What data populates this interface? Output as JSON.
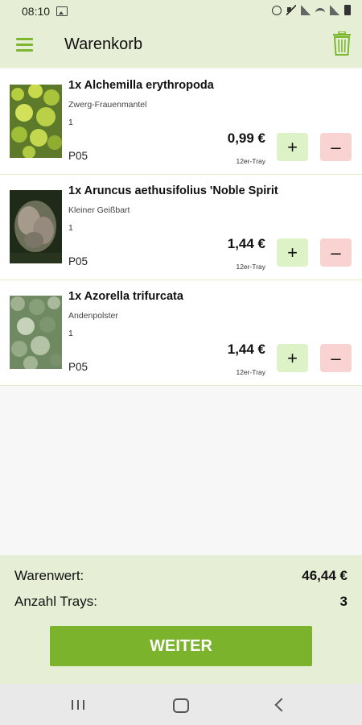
{
  "status_bar": {
    "time": "08:10"
  },
  "app_bar": {
    "title": "Warenkorb"
  },
  "items": [
    {
      "name": "1x Alchemilla erythropoda",
      "subtitle": "Zwerg-Frauenmantel",
      "qty": "1",
      "code": "P05",
      "price": "0,99 €",
      "unit": "12er-Tray",
      "plus": "+",
      "minus": "–"
    },
    {
      "name": "1x Aruncus aethusifolius 'Noble Spirit",
      "subtitle": "Kleiner Geißbart",
      "qty": "1",
      "code": "P05",
      "price": "1,44 €",
      "unit": "12er-Tray",
      "plus": "+",
      "minus": "–"
    },
    {
      "name": "1x Azorella trifurcata",
      "subtitle": "Andenpolster",
      "qty": "1",
      "code": "P05",
      "price": "1,44 €",
      "unit": "12er-Tray",
      "plus": "+",
      "minus": "–"
    }
  ],
  "summary": {
    "total_label": "Warenwert:",
    "total_value": "46,44 €",
    "trays_label": "Anzahl Trays:",
    "trays_value": "3",
    "next_button": "WEITER"
  },
  "colors": {
    "accent": "#7cb32c",
    "header_bg": "#e6efd6",
    "plus_bg": "#ddf3c7",
    "minus_bg": "#f9d2d2"
  }
}
